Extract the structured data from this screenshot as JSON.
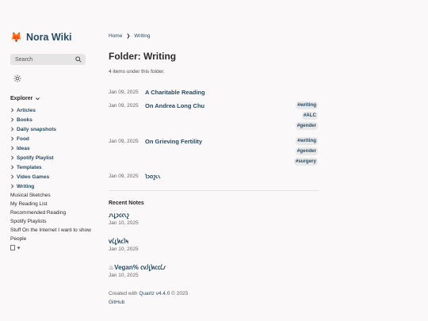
{
  "site": {
    "logo": "🦊",
    "title": "Nora Wiki"
  },
  "search": {
    "placeholder": "Search"
  },
  "explorer": {
    "heading": "Explorer",
    "folders": [
      "Articles",
      "Books",
      "Daily snapshots",
      "Food",
      "Ideas",
      "Spotify Playlist",
      "Templates",
      "Video Games",
      "Writing"
    ],
    "files": [
      "Musical Sketches",
      "My Reading List",
      "Recommended Reading",
      "Spotify Playlists",
      "Stuff On the Internet I want to show",
      "People"
    ]
  },
  "breadcrumb": {
    "home": "Home",
    "sep": "❯",
    "current": "Writing"
  },
  "page": {
    "title": "Folder: Writing",
    "count": "4 items under this folder."
  },
  "items": [
    {
      "date": "Jan 09, 2025",
      "title": "A Charitable Reading",
      "tags": []
    },
    {
      "date": "Jan 09, 2025",
      "title": "On Andrea Long Chu",
      "tags": [
        "#writing",
        "#ALC",
        "#gender"
      ]
    },
    {
      "date": "Jan 09, 2025",
      "title": "On Grieving Fertility",
      "tags": [
        "#writing",
        "#gender",
        "#surgery"
      ]
    },
    {
      "date": "Jan 09, 2025",
      "title": "𐑐𐑮𐑴𐑟𐑧𐑯",
      "tags": []
    }
  ],
  "recent": {
    "heading": "Recent Notes",
    "notes": [
      {
        "title": "𐑨𐑯𐑛𐑮𐑤𐑬𐑯𐑟",
        "date": "Jan 10, 2025"
      },
      {
        "title": "𐑫𐑖𐑛𐑿𐑤𐑐𐑰",
        "date": "Jan 10, 2025"
      },
      {
        "title": "♨Vegan% 𐑤𐑫𐑓𐑛𐑿𐑤𐑤𐑖𐑥",
        "date": "Jan 10, 2025"
      }
    ]
  },
  "footer": {
    "created": "Created with",
    "quartz": "Quartz v4.4.0",
    "copyright": "© 2025",
    "github": "GitHub"
  }
}
